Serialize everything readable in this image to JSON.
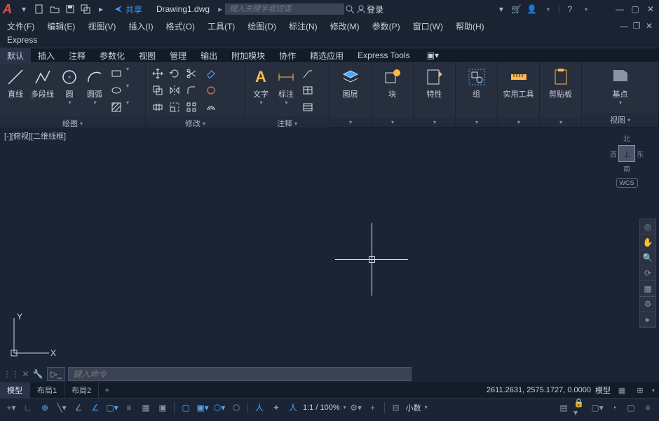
{
  "titlebar": {
    "share": "共享",
    "doc_title": "Drawing1.dwg",
    "search_placeholder": "键入关键字或短语",
    "login": "登录"
  },
  "menubar": {
    "items": [
      "文件(F)",
      "编辑(E)",
      "视图(V)",
      "插入(I)",
      "格式(O)",
      "工具(T)",
      "绘图(D)",
      "标注(N)",
      "修改(M)",
      "参数(P)",
      "窗口(W)",
      "帮助(H)"
    ]
  },
  "express": "Express",
  "ribbon_tabs": [
    "默认",
    "插入",
    "注释",
    "参数化",
    "视图",
    "管理",
    "输出",
    "附加模块",
    "协作",
    "精选应用",
    "Express Tools"
  ],
  "panels": {
    "draw": {
      "title": "绘图",
      "line": "直线",
      "polyline": "多段线",
      "circle": "圆",
      "arc": "圆弧"
    },
    "modify": {
      "title": "修改"
    },
    "annotate": {
      "title": "注释",
      "text": "文字",
      "dim": "标注"
    },
    "layers": {
      "title": "图层"
    },
    "block": {
      "title": "块"
    },
    "props": {
      "title": "特性"
    },
    "group": {
      "title": "组"
    },
    "util": {
      "title": "实用工具"
    },
    "clip": {
      "title": "剪贴板"
    },
    "view": {
      "title": "视图",
      "base": "基点"
    }
  },
  "viewport_label": "[-][俯视][二维线框]",
  "viewcube": {
    "n": "北",
    "s": "南",
    "e": "东",
    "w": "西",
    "top": "上",
    "wcs": "WCS"
  },
  "ucs": {
    "x": "X",
    "y": "Y"
  },
  "cmdline": {
    "placeholder": "键入命令"
  },
  "model_tabs": {
    "model": "模型",
    "layout1": "布局1",
    "layout2": "布局2"
  },
  "coords": "2611.2631, 2575.1727, 0.0000",
  "coord_model": "模型",
  "status": {
    "scale": "1:1 / 100%",
    "units": "小数"
  }
}
